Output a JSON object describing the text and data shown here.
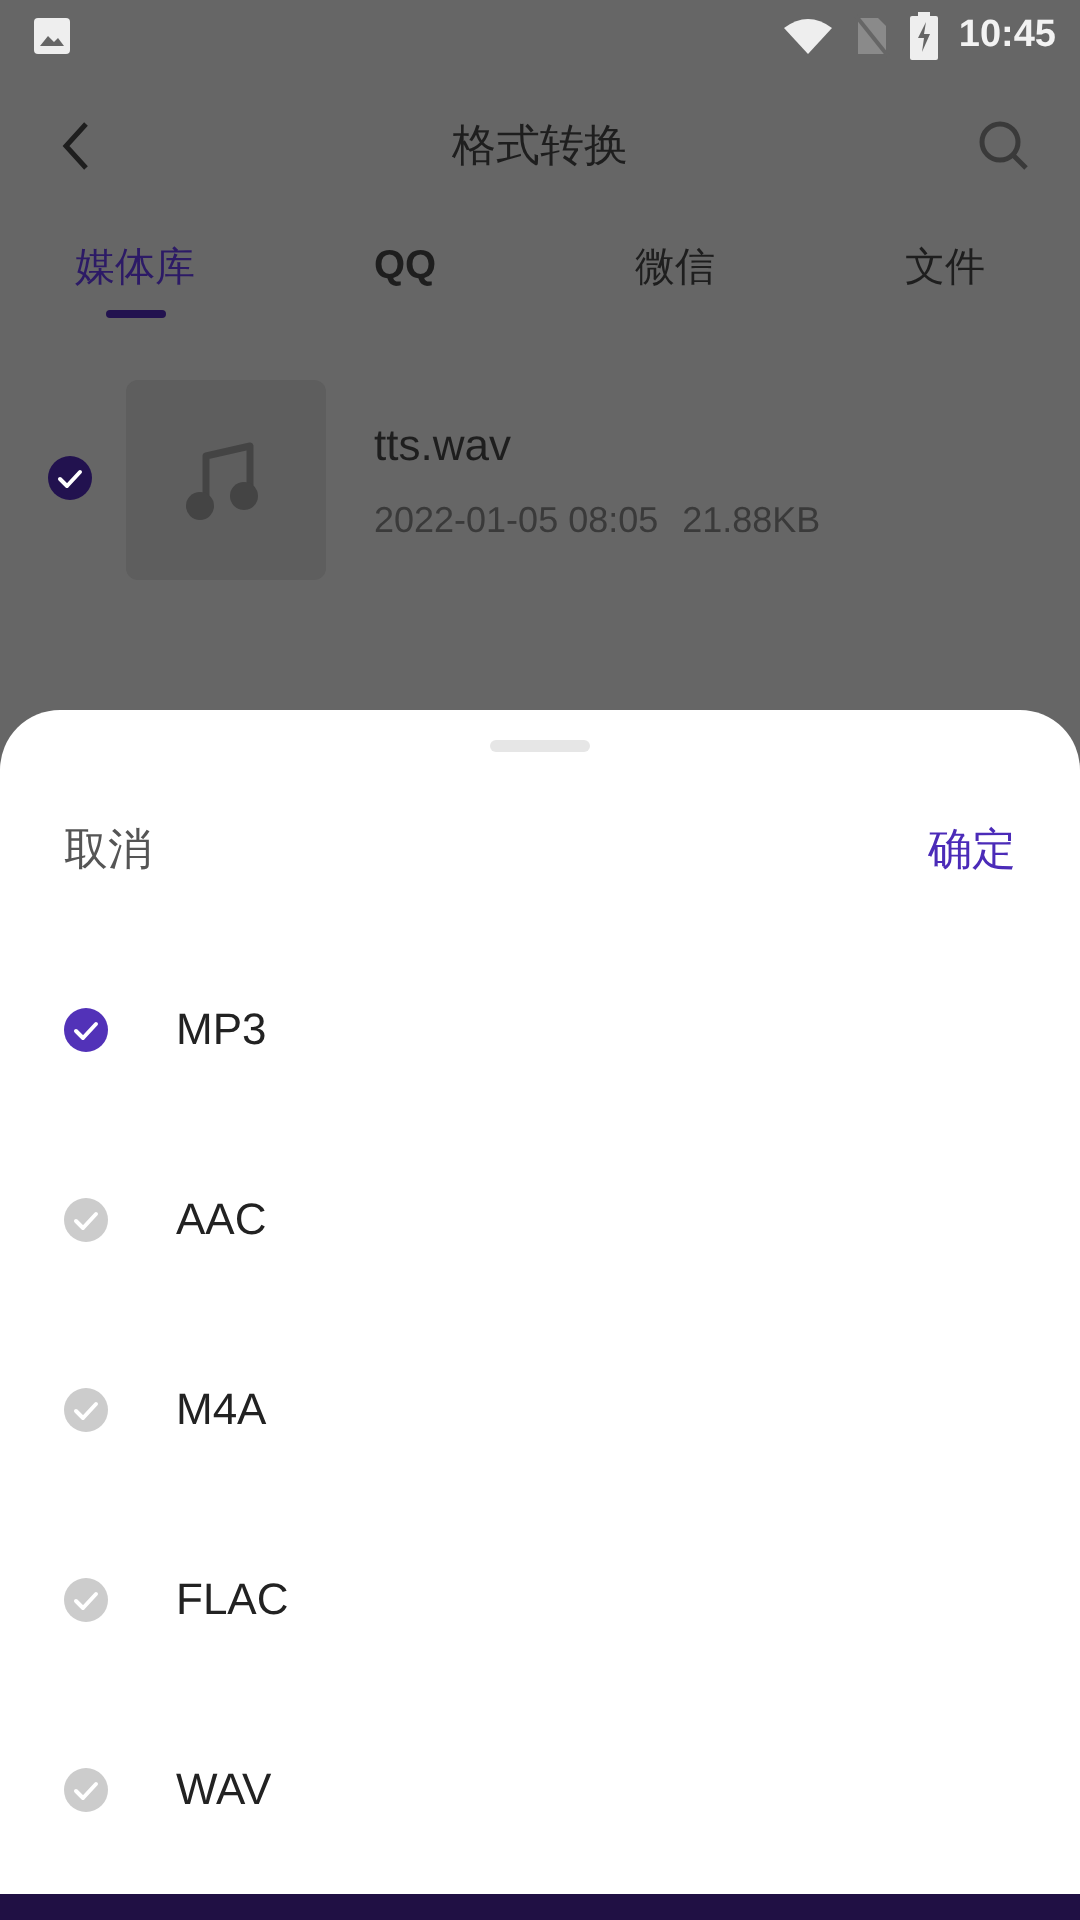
{
  "status_bar": {
    "time": "10:45"
  },
  "app_bar": {
    "title": "格式转换"
  },
  "tabs": [
    {
      "label": "媒体库",
      "selected": true
    },
    {
      "label": "QQ",
      "selected": false
    },
    {
      "label": "微信",
      "selected": false
    },
    {
      "label": "文件",
      "selected": false
    }
  ],
  "files": [
    {
      "name": "tts.wav",
      "date": "2022-01-05 08:05",
      "size": "21.88KB",
      "checked": true
    }
  ],
  "sheet": {
    "cancel": "取消",
    "confirm": "确定",
    "options": [
      {
        "label": "MP3",
        "selected": true
      },
      {
        "label": "AAC",
        "selected": false
      },
      {
        "label": "M4A",
        "selected": false
      },
      {
        "label": "FLAC",
        "selected": false
      },
      {
        "label": "WAV",
        "selected": false
      }
    ]
  }
}
